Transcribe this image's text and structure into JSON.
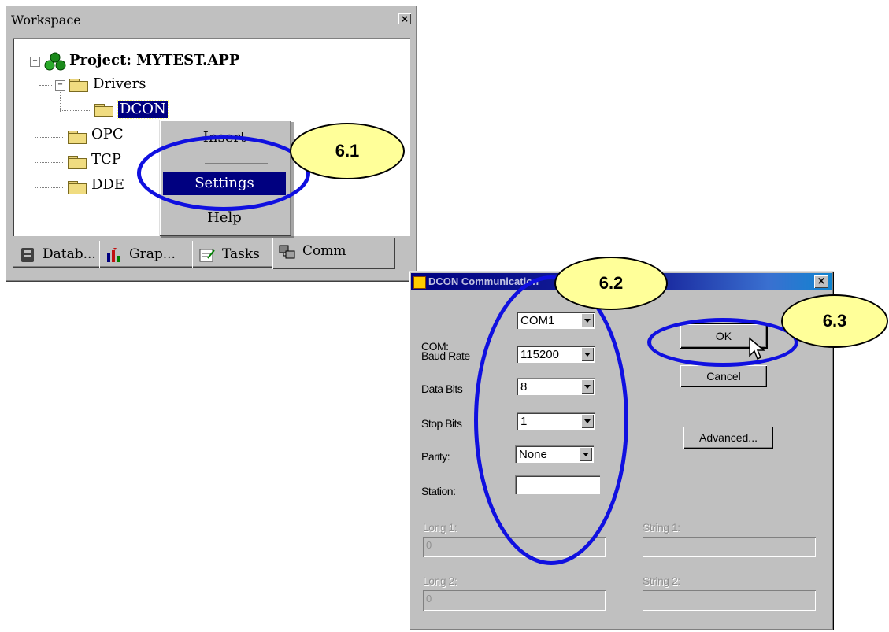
{
  "workspace": {
    "title": "Workspace",
    "close_glyph": "×",
    "tree": {
      "project": "Project: MYTEST.APP",
      "drivers": "Drivers",
      "dcon": "DCON",
      "opc": "OPC",
      "tcp": "TCP",
      "dde": "DDE",
      "expand_glyph": "−"
    },
    "tabs": [
      {
        "label": "Datab...",
        "icon": "database-icon"
      },
      {
        "label": "Grap...",
        "icon": "graphics-icon"
      },
      {
        "label": "Tasks",
        "icon": "tasks-icon"
      },
      {
        "label": "Comm",
        "icon": "comm-icon",
        "active": true
      }
    ]
  },
  "context_menu": {
    "items": [
      "Insert",
      "Settings",
      "Help"
    ],
    "highlighted": "Settings"
  },
  "dialog": {
    "title": "DCON Communication",
    "close_glyph": "×",
    "fields": {
      "com_label": "COM:",
      "com_value": "COM1",
      "baud_label": "Baud Rate",
      "baud_value": "115200",
      "databits_label": "Data Bits",
      "databits_value": "8",
      "stopbits_label": "Stop Bits",
      "stopbits_value": "1",
      "parity_label": "Parity:",
      "parity_value": "None",
      "station_label": "Station:",
      "station_value": "",
      "long1_label": "Long 1:",
      "long1_value": "0",
      "string1_label": "String 1:",
      "string1_value": "",
      "long2_label": "Long 2:",
      "long2_value": "0",
      "string2_label": "String 2:",
      "string2_value": ""
    },
    "buttons": {
      "ok": "OK",
      "cancel": "Cancel",
      "advanced": "Advanced..."
    }
  },
  "annotations": {
    "step1": "6.1",
    "step2": "6.2",
    "step3": "6.3",
    "highlight_color": "#1010e0",
    "callout_color": "#ffff99"
  }
}
